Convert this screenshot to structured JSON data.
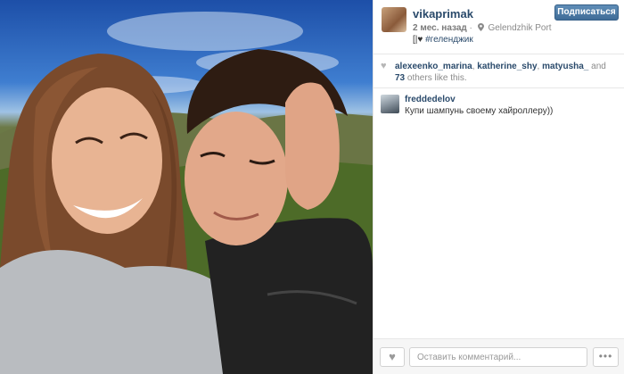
{
  "post": {
    "username": "vikaprimak",
    "time": "2 мес. назад",
    "location": "Gelendzhik Port",
    "caption_hashtag": "#геленджик",
    "follow_label": "Подписаться"
  },
  "likes": {
    "users": [
      "alexeenko_marina",
      "katherine_shy",
      "matyusha_"
    ],
    "and_text": "and",
    "count": "73",
    "suffix": "others like this."
  },
  "comments": [
    {
      "user": "freddedelov",
      "text": "Купи шампунь своему хайроллеру))"
    }
  ],
  "footer": {
    "comment_placeholder": "Оставить комментарий...",
    "more_label": "•••"
  },
  "icons": {
    "heart": "heart-icon",
    "pin": "location-pin-icon",
    "more": "ellipsis-icon"
  },
  "colors": {
    "link": "#2a4a6b",
    "follow_button": "#4a78a4",
    "muted_text": "#8a8a8a"
  }
}
